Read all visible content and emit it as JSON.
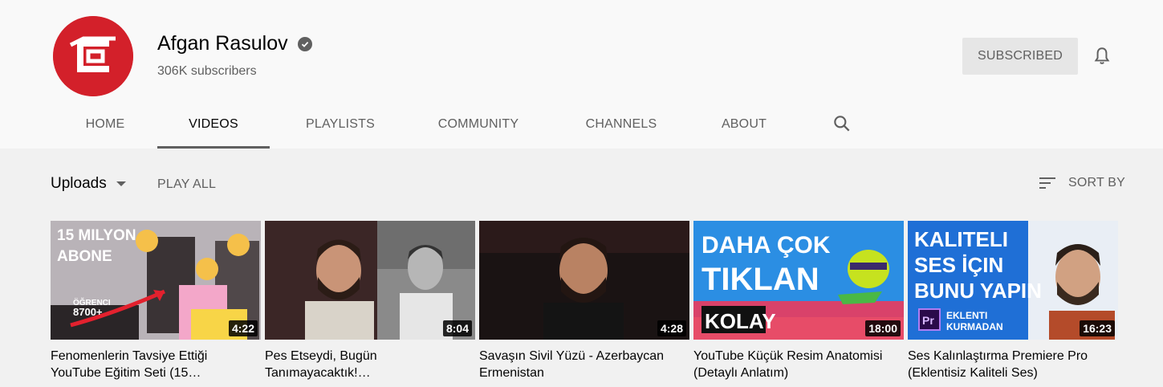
{
  "channel": {
    "name": "Afgan Rasulov",
    "subscribers": "306K subscribers",
    "subscribe_label": "SUBSCRIBED",
    "brand_color": "#d3202a"
  },
  "tabs": [
    {
      "label": "HOME"
    },
    {
      "label": "VIDEOS"
    },
    {
      "label": "PLAYLISTS"
    },
    {
      "label": "COMMUNITY"
    },
    {
      "label": "CHANNELS"
    },
    {
      "label": "ABOUT"
    }
  ],
  "active_tab": "VIDEOS",
  "toolbar": {
    "uploads_label": "Uploads",
    "play_all_label": "PLAY ALL",
    "sort_label": "SORT BY"
  },
  "videos": [
    {
      "title": "Fenomenlerin Tavsiye Ettiği YouTube Eğitim Seti (15…",
      "duration": "4:22",
      "thumb_text": [
        "15 MILYON",
        "ABONE",
        "ÖĞRENCI",
        "8700+"
      ]
    },
    {
      "title": "Pes Etseydi, Bugün Tanımayacaktık!…",
      "duration": "8:04"
    },
    {
      "title": "Savaşın Sivil Yüzü - Azerbaycan Ermenistan",
      "duration": "4:28"
    },
    {
      "title": "YouTube Küçük Resim Anatomisi (Detaylı Anlatım)",
      "duration": "18:00",
      "thumb_text": [
        "DAHA ÇOK",
        "TIKLAN",
        "KOLAY"
      ]
    },
    {
      "title": "Ses Kalınlaştırma Premiere Pro (Eklentisiz Kaliteli Ses)",
      "duration": "16:23",
      "thumb_text": [
        "KALITELI",
        "SES İÇIN",
        "BUNU YAPIN",
        "Pr",
        "EKLENTI",
        "KURMADAN"
      ]
    }
  ]
}
